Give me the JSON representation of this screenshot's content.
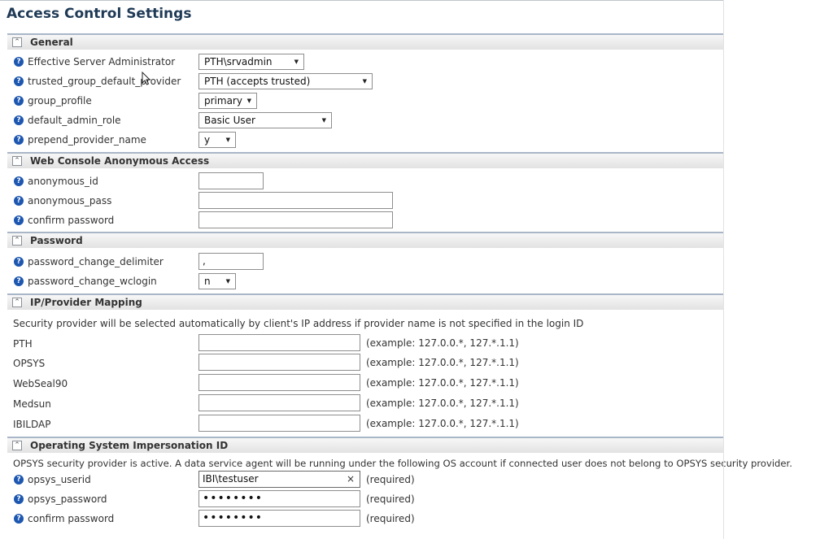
{
  "page": {
    "title": "Access Control Settings"
  },
  "sections": {
    "general": {
      "title": "General",
      "rows": [
        {
          "label": "Effective Server Administrator",
          "value": "PTH\\srvadmin"
        },
        {
          "label": "trusted_group_default_provider",
          "value": "PTH (accepts trusted)"
        },
        {
          "label": "group_profile",
          "value": "primary"
        },
        {
          "label": "default_admin_role",
          "value": "Basic User"
        },
        {
          "label": "prepend_provider_name",
          "value": "y"
        }
      ]
    },
    "web_console": {
      "title": "Web Console Anonymous Access",
      "rows": [
        {
          "label": "anonymous_id",
          "value": ""
        },
        {
          "label": "anonymous_pass",
          "value": ""
        },
        {
          "label": "confirm password",
          "value": ""
        }
      ]
    },
    "password": {
      "title": "Password",
      "rows": [
        {
          "label": "password_change_delimiter",
          "value": ","
        },
        {
          "label": "password_change_wclogin",
          "value": "n"
        }
      ]
    },
    "ip_mapping": {
      "title": "IP/Provider Mapping",
      "description": "Security provider will be selected automatically by client's IP address if provider name is not specified in the login ID",
      "example": "(example: 127.0.0.*, 127.*.1.1)",
      "rows": [
        {
          "label": "PTH",
          "value": ""
        },
        {
          "label": "OPSYS",
          "value": ""
        },
        {
          "label": "WebSeal90",
          "value": ""
        },
        {
          "label": "Medsun",
          "value": ""
        },
        {
          "label": "IBILDAP",
          "value": ""
        }
      ]
    },
    "impersonation": {
      "title": "Operating System Impersonation ID",
      "description": "OPSYS security provider is active. A data service agent will be running under the following OS account if connected user does not belong to OPSYS security provider.",
      "required": "(required)",
      "rows": [
        {
          "label": "opsys_userid",
          "value": "IBI\\testuser"
        },
        {
          "label": "opsys_password",
          "value": "••••••••"
        },
        {
          "label": "confirm password",
          "value": "••••••••"
        }
      ]
    }
  },
  "icons": {
    "help": "?",
    "collapse": "⌃",
    "caret": "▼",
    "clear": "×"
  }
}
